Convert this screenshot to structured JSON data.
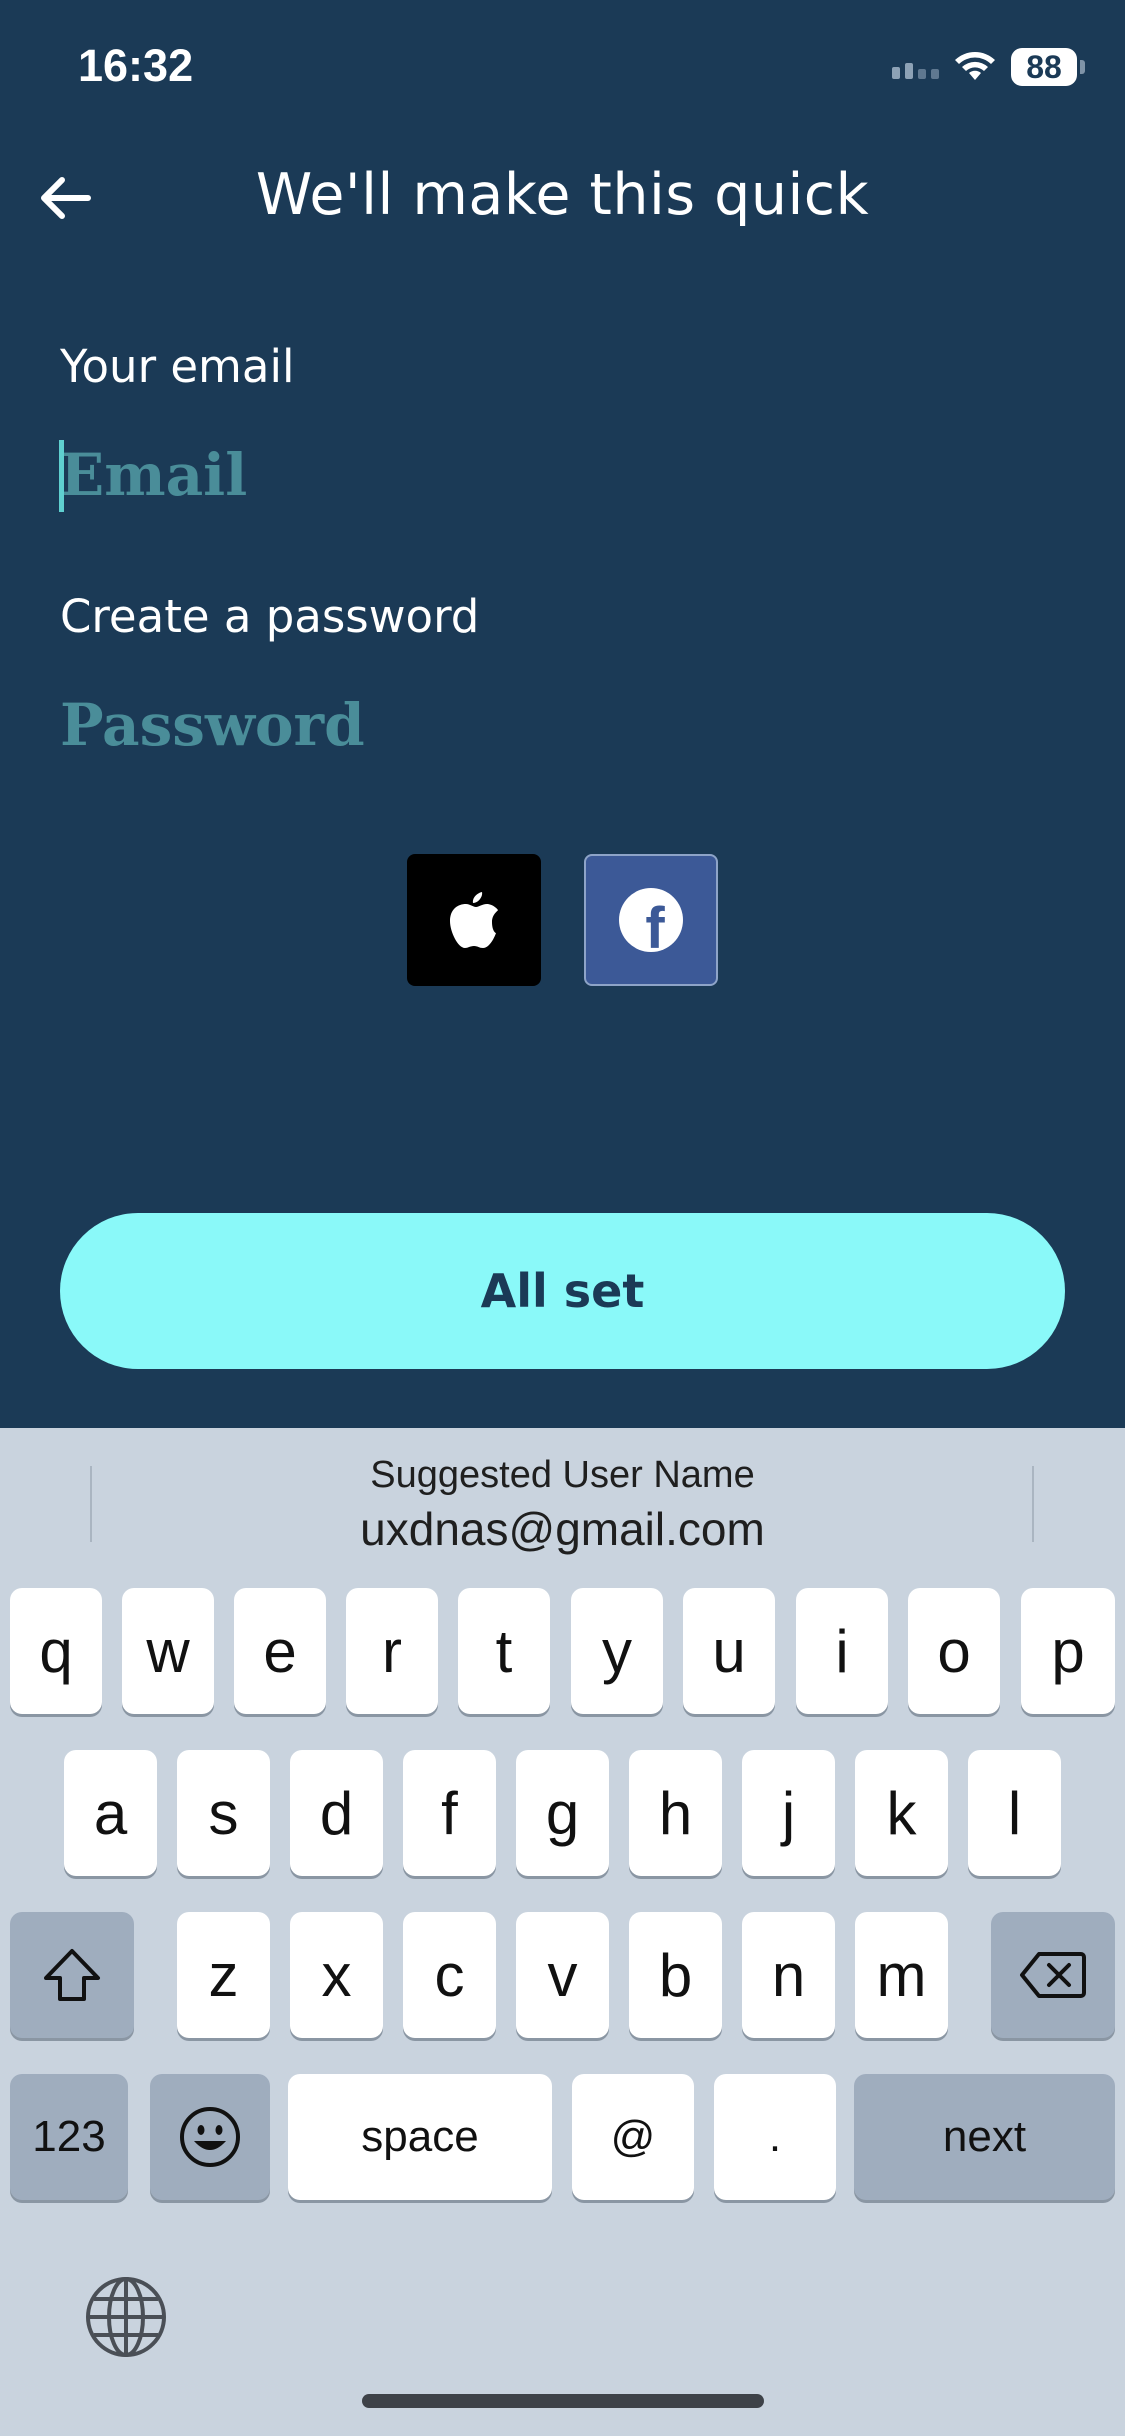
{
  "status_bar": {
    "time": "16:32",
    "battery": "88"
  },
  "header": {
    "title": "We'll make this quick"
  },
  "form": {
    "email_label": "Your email",
    "email_placeholder": "Email",
    "password_label": "Create a password",
    "password_placeholder": "Password"
  },
  "social": {
    "apple_icon": "apple-icon",
    "facebook_icon": "facebook-icon",
    "facebook_glyph": "f"
  },
  "primary_button": {
    "label": "All set"
  },
  "colors": {
    "background": "#1b3a56",
    "accent": "#8af9f9",
    "placeholder": "#4a8d99",
    "keyboard": "#c9d3de"
  },
  "keyboard": {
    "suggestion_title": "Suggested User Name",
    "suggestion_value": "uxdnas@gmail.com",
    "row1": [
      "q",
      "w",
      "e",
      "r",
      "t",
      "y",
      "u",
      "i",
      "o",
      "p"
    ],
    "row2": [
      "a",
      "s",
      "d",
      "f",
      "g",
      "h",
      "j",
      "k",
      "l"
    ],
    "row3": [
      "z",
      "x",
      "c",
      "v",
      "b",
      "n",
      "m"
    ],
    "bottom": {
      "numbers": "123",
      "space": "space",
      "at": "@",
      "dot": ".",
      "next": "next"
    }
  }
}
